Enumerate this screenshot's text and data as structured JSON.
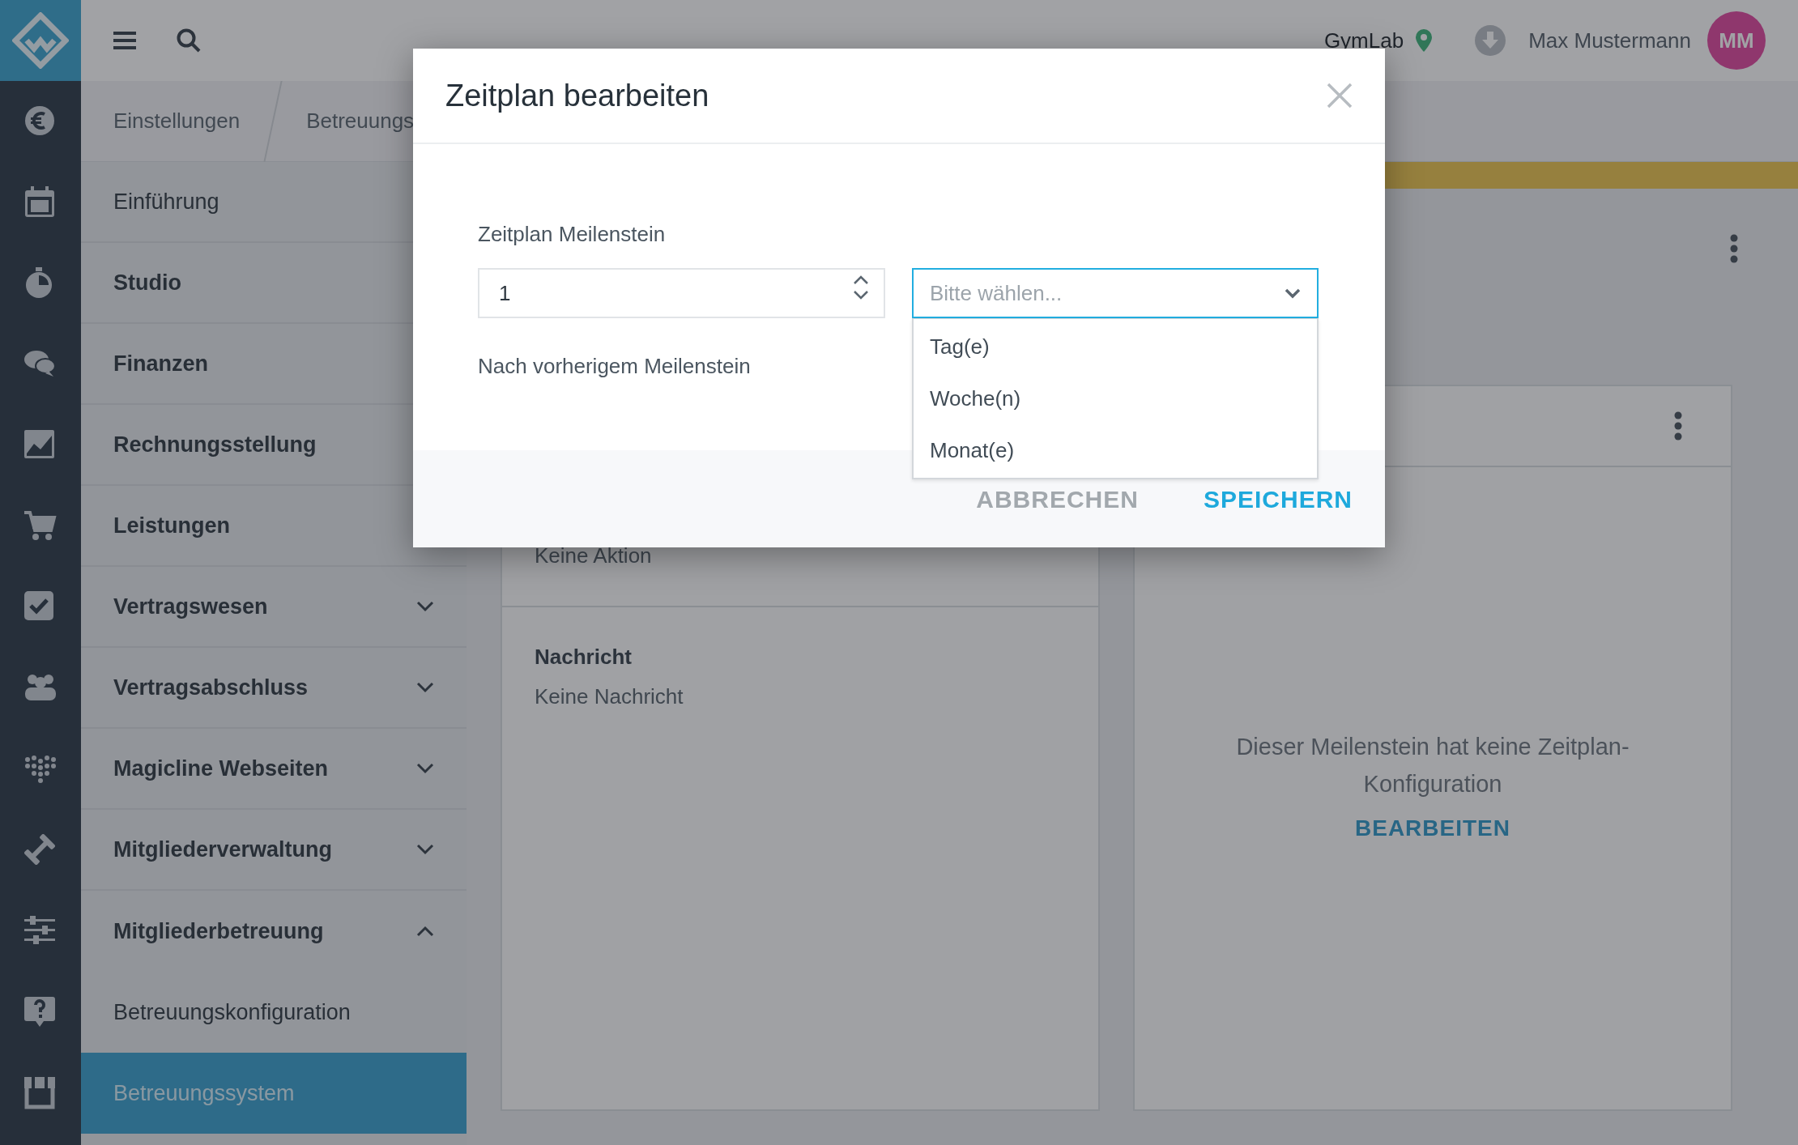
{
  "top_bar": {
    "location": "GymLab",
    "user_name": "Max Mustermann",
    "avatar_initials": "MM"
  },
  "breadcrumb": [
    "Einstellungen",
    "Betreuungs"
  ],
  "sidebar": {
    "items": [
      {
        "label": "Einführung",
        "kind": "page",
        "selected": false
      },
      {
        "label": "Studio",
        "kind": "section",
        "selected": false
      },
      {
        "label": "Finanzen",
        "kind": "section",
        "selected": false
      },
      {
        "label": "Rechnungsstellung",
        "kind": "section",
        "selected": false
      },
      {
        "label": "Leistungen",
        "kind": "section",
        "selected": false
      },
      {
        "label": "Vertragswesen",
        "kind": "group",
        "selected": false,
        "expanded": false
      },
      {
        "label": "Vertragsabschluss",
        "kind": "group",
        "selected": false,
        "expanded": false
      },
      {
        "label": "Magicline Webseiten",
        "kind": "group",
        "selected": false,
        "expanded": false
      },
      {
        "label": "Mitgliederverwaltung",
        "kind": "group",
        "selected": false,
        "expanded": false
      },
      {
        "label": "Mitgliederbetreuung",
        "kind": "group",
        "selected": false,
        "expanded": true,
        "children": [
          {
            "label": "Betreuungskonfiguration",
            "kind": "page",
            "selected": false
          },
          {
            "label": "Betreuungssystem",
            "kind": "page",
            "selected": true
          }
        ]
      }
    ]
  },
  "cards": [
    {
      "kind": "details",
      "rows": [
        {
          "value": "Keine Aktion"
        },
        {
          "heading": "Nachricht",
          "value": "Keine Nachricht"
        }
      ]
    },
    {
      "kind": "empty",
      "message": "Dieser Meilenstein hat keine Zeitplan-Konfiguration",
      "action": "BEARBEITEN"
    }
  ],
  "modal": {
    "title": "Zeitplan bearbeiten",
    "field_label": "Zeitplan Meilenstein",
    "number_value": "1",
    "select": {
      "placeholder": "Bitte wählen...",
      "expanded": true,
      "options": [
        {
          "label": "Tag(e)",
          "selected": false
        },
        {
          "label": "Woche(n)",
          "selected": false
        },
        {
          "label": "Monat(e)",
          "selected": false
        }
      ]
    },
    "hint": "Nach vorherigem Meilenstein",
    "buttons": [
      {
        "label": "ABBRECHEN",
        "kind": "secondary"
      },
      {
        "label": "SPEICHERN",
        "kind": "primary"
      }
    ]
  }
}
